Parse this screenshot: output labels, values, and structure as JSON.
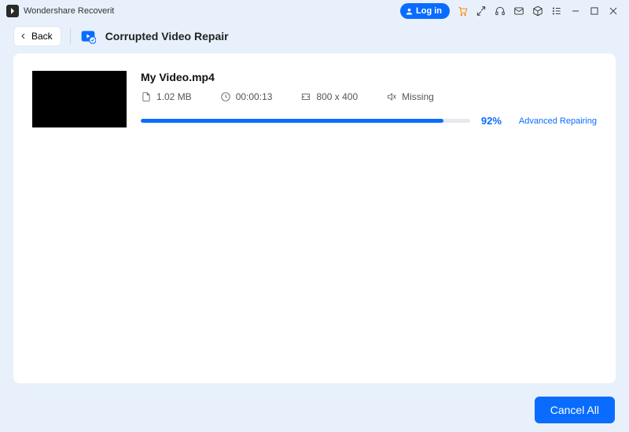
{
  "app": {
    "title": "Wondershare Recoverit"
  },
  "titlebar": {
    "login_label": "Log in"
  },
  "subheader": {
    "back_label": "Back",
    "page_title": "Corrupted Video Repair"
  },
  "file": {
    "name": "My Video.mp4",
    "size": "1.02  MB",
    "duration": "00:00:13",
    "resolution": "800 x 400",
    "audio_status": "Missing",
    "progress_pct": 92,
    "progress_label": "92%",
    "status_label": "Advanced Repairing"
  },
  "footer": {
    "cancel_label": "Cancel All"
  },
  "colors": {
    "accent": "#0a6cff",
    "cart": "#ff7a00"
  }
}
